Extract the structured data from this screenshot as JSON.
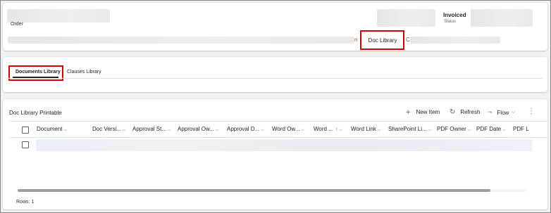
{
  "header": {
    "order_label": "Order",
    "status_value": "Invoiced",
    "status_label": "Status",
    "truncated_left": "n",
    "doc_library_tab": "Doc Library",
    "truncated_right": "C"
  },
  "tabs": {
    "items": [
      "Documents Library",
      "Clauses Library"
    ]
  },
  "grid": {
    "title": "Doc Library Printable",
    "commands": {
      "new_item": "New Item",
      "refresh": "Refresh",
      "flow": "Flow"
    },
    "columns": [
      "Document",
      "Doc Versi...",
      "Approval St...",
      "Approval Ow...",
      "Approval D...",
      "Word Ow...",
      "Word ...",
      "Word Link",
      "SharePoint Li...",
      "PDF Owner",
      "PDF Date",
      "PDF L"
    ],
    "rows_label": "Rows: 1"
  },
  "icons": {
    "add": "plus-icon",
    "refresh": "refresh-icon",
    "flow": "flow-icon",
    "more": "more-icon",
    "chevron": "chevron-down-icon",
    "sort": "sort-up-icon"
  },
  "colors": {
    "highlight": "#d20000",
    "background": "#f3f2f1"
  }
}
